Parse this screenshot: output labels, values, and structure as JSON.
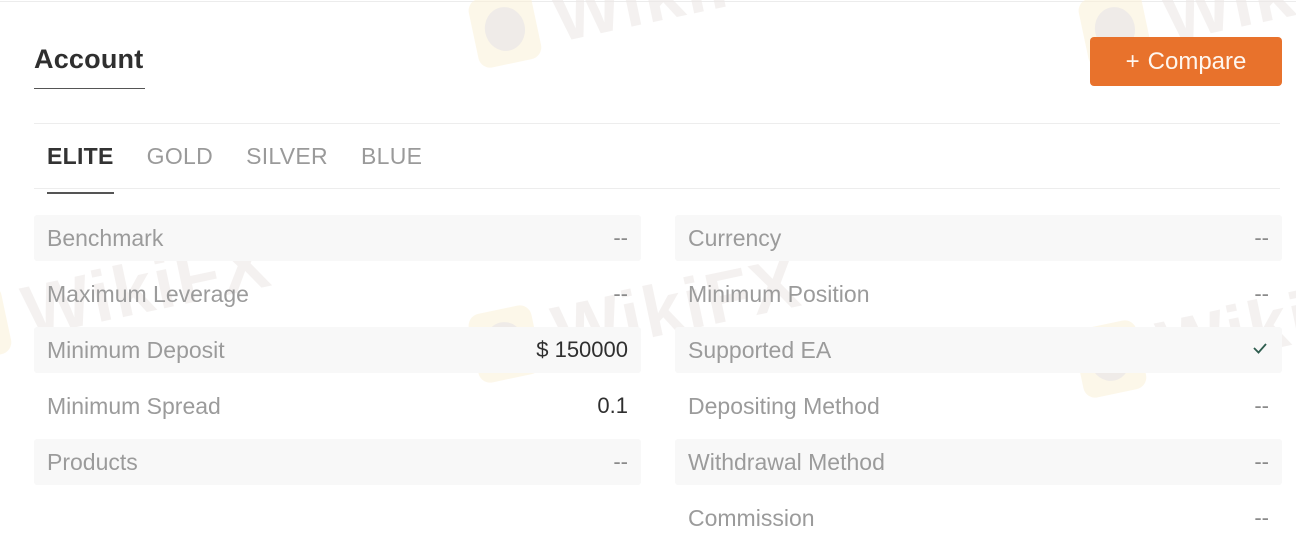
{
  "header": {
    "title": "Account",
    "compare_button": {
      "icon": "plus-icon",
      "icon_glyph": "+",
      "label": "Compare",
      "color": "#e8722c"
    }
  },
  "tabs": [
    {
      "label": "ELITE",
      "active": true
    },
    {
      "label": "GOLD",
      "active": false
    },
    {
      "label": "SILVER",
      "active": false
    },
    {
      "label": "BLUE",
      "active": false
    }
  ],
  "left_rows": [
    {
      "label": "Benchmark",
      "value": "--"
    },
    {
      "label": "Maximum Leverage",
      "value": "--"
    },
    {
      "label": "Minimum Deposit",
      "value": "$ 150000"
    },
    {
      "label": "Minimum Spread",
      "value": "0.1"
    },
    {
      "label": "Products",
      "value": "--"
    }
  ],
  "right_rows": [
    {
      "label": "Currency",
      "value": "--"
    },
    {
      "label": "Minimum Position",
      "value": "--"
    },
    {
      "label": "Supported EA",
      "value": "",
      "icon": "check-icon",
      "icon_color": "#2f5d4f"
    },
    {
      "label": "Depositing Method",
      "value": "--"
    },
    {
      "label": "Withdrawal Method",
      "value": "--"
    },
    {
      "label": "Commission",
      "value": "--"
    }
  ],
  "watermark": {
    "text": "WikiFX"
  }
}
